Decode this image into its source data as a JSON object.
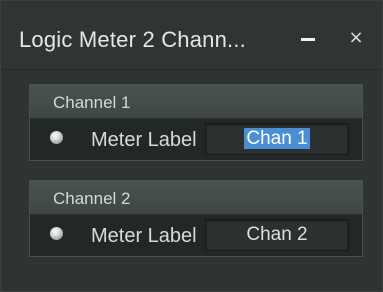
{
  "window": {
    "title": "Logic Meter 2 Chann...",
    "minimize_icon": "minimize-icon",
    "close_glyph": "×"
  },
  "channels": [
    {
      "name": "Channel 1",
      "meter_label_caption": "Meter Label",
      "meter_label_value": "Chan 1",
      "value_selected": true,
      "led_color": "#c8cccc"
    },
    {
      "name": "Channel 2",
      "meter_label_caption": "Meter Label",
      "meter_label_value": "Chan 2",
      "value_selected": false,
      "led_color": "#c8cccc"
    }
  ],
  "colors": {
    "selection": "#4a8fd4",
    "panel_bg": "#2e3333",
    "group_header": "#474e4e"
  }
}
